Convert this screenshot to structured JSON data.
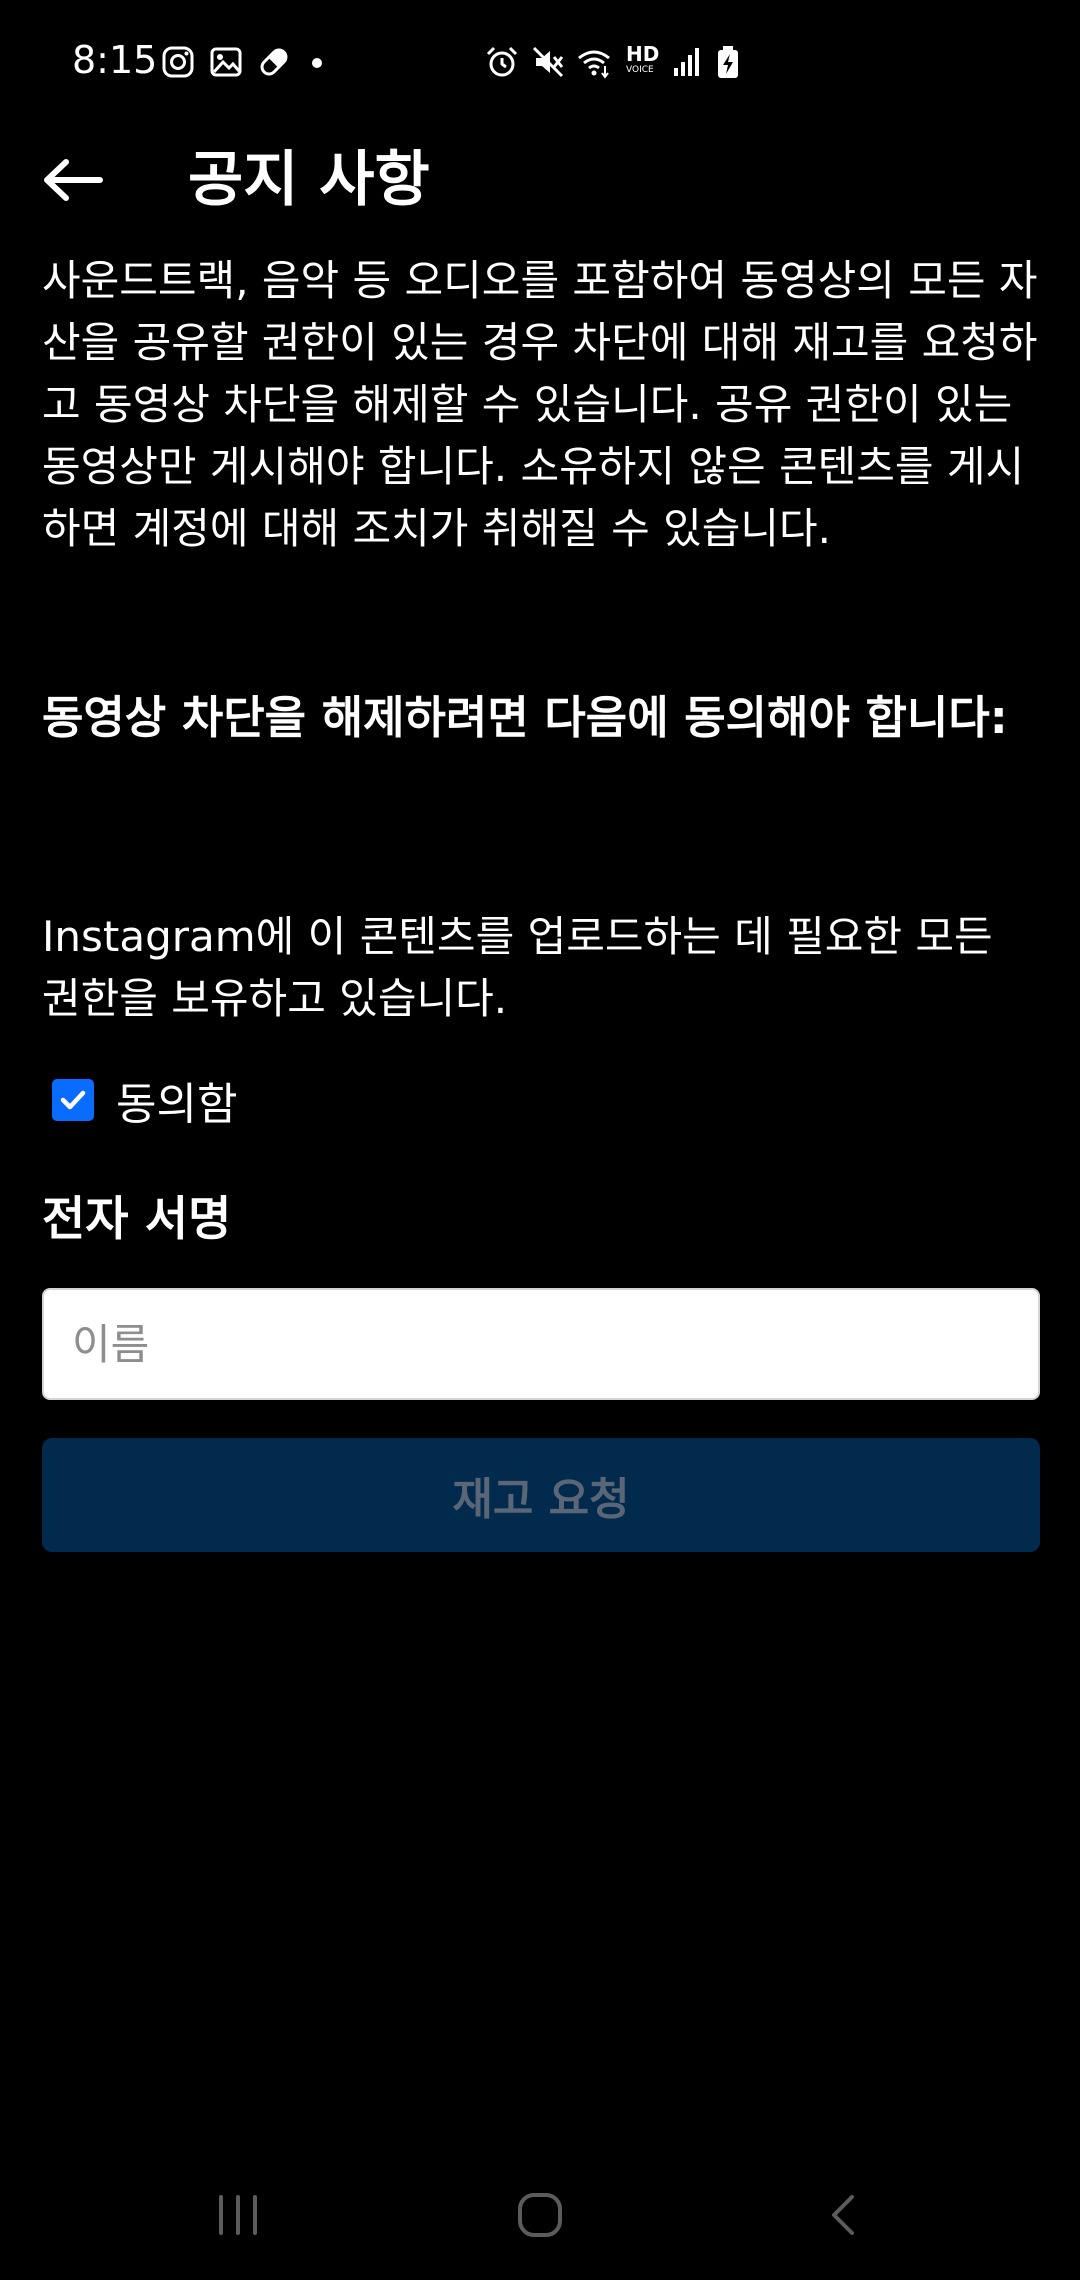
{
  "status_bar": {
    "time": "8:15",
    "left_icons": [
      "instagram-icon",
      "gallery-icon",
      "pill-icon",
      "notification-dot-icon"
    ],
    "right_icons": [
      "alarm-icon",
      "mute-icon",
      "wifi-icon",
      "hd-voice-icon",
      "signal-icon",
      "battery-charging-icon"
    ],
    "hd_voice_top": "HD",
    "hd_voice_bottom": "VOICE"
  },
  "header": {
    "back_icon": "arrow-left-icon",
    "title": "공지 사항"
  },
  "notice": {
    "body": "사운드트랙, 음악 등 오디오를 포함하여 동영상의 모든 자산을 공유할 권한이 있는 경우 차단에 대해 재고를 요청하고 동영상 차단을 해제할 수 있습니다. 공유 권한이 있는 동영상만 게시해야 합니다. 소유하지 않은 콘텐츠를 게시하면 계정에 대해 조치가 취해질 수 있습니다.",
    "agree_heading": "동영상 차단을 해제하려면 다음에 동의해야 합니다:",
    "rights_statement": "Instagram에 이 콘텐츠를 업로드하는 데 필요한 모든 권한을 보유하고 있습니다."
  },
  "agreement": {
    "checked": true,
    "label": "동의함"
  },
  "signature": {
    "heading": "전자 서명",
    "placeholder": "이름",
    "value": ""
  },
  "submit": {
    "label": "재고 요청"
  },
  "nav_bar": {
    "icons": [
      "recent-apps-icon",
      "home-icon",
      "back-icon"
    ]
  },
  "colors": {
    "background": "#000000",
    "text": "#ffffff",
    "checkbox_accent": "#0a6cff",
    "button_background": "#012a4d",
    "button_text": "#5a6677",
    "placeholder": "#8e8e8e"
  }
}
